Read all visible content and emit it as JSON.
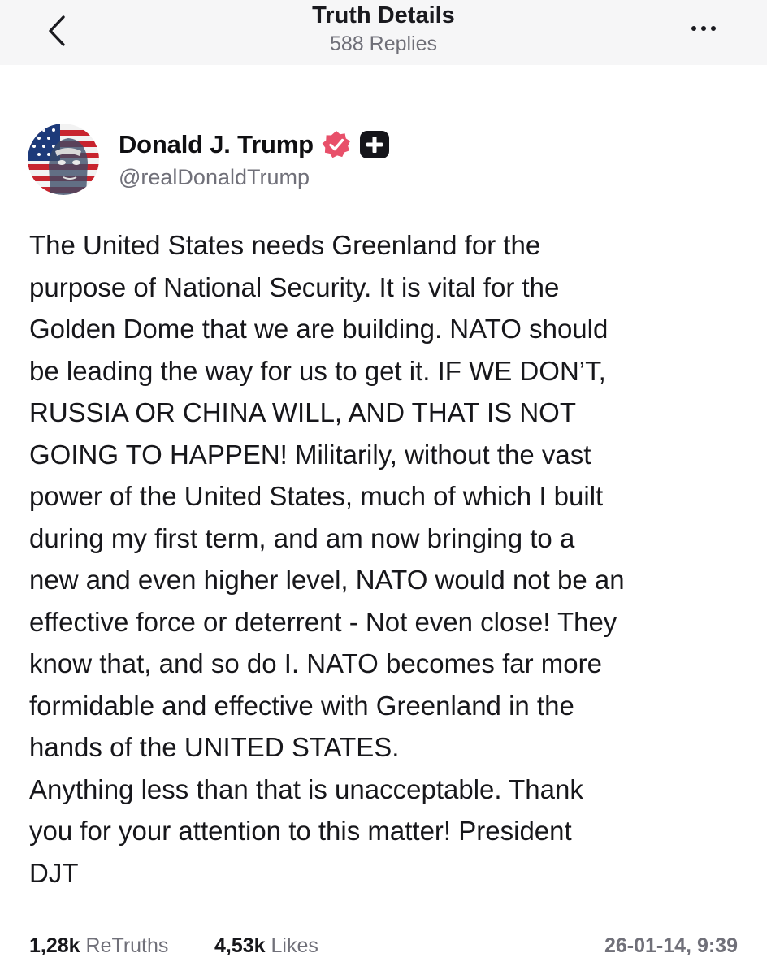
{
  "header": {
    "title": "Truth Details",
    "subtitle": "588 Replies",
    "back_icon": "chevron-left-icon",
    "more_icon": "ellipsis-icon"
  },
  "post": {
    "author_name": "Donald J. Trump",
    "handle": "@realDonaldTrump",
    "verified_icon": "verified-badge-icon",
    "verified_color": "#e8506a",
    "plus_icon": "truth-plus-badge-icon",
    "text": "The United States needs Greenland for the\npurpose of National Security. It is vital for the\nGolden Dome that we are building. NATO should\nbe leading the way for us to get it. IF WE DON’T,\nRUSSIA OR CHINA WILL, AND THAT IS NOT\nGOING TO HAPPEN! Militarily, without the vast\npower of the United States, much of which I built\nduring my first term, and am now bringing to a\nnew and even higher level, NATO would not be an\neffective force or deterrent - Not even close! They\nknow that, and so do I. NATO becomes far more\nformidable and effective with Greenland in the\nhands of the UNITED STATES.\nAnything less than that is unacceptable. Thank\nyou for your attention to this matter! President\nDJT"
  },
  "footer": {
    "retruths_count": "1,28k",
    "retruths_label": "ReTruths",
    "likes_count": "4,53k",
    "likes_label": "Likes",
    "timestamp": "26-01-14, 9:39"
  }
}
